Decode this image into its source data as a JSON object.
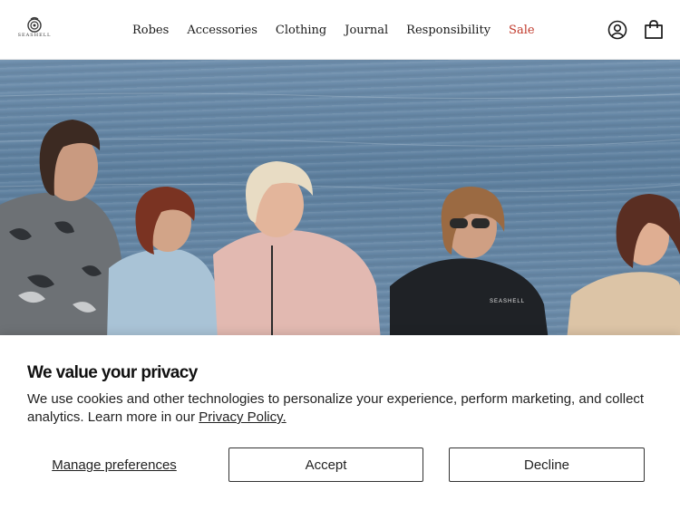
{
  "brand": {
    "logo_text": "SEASHELL"
  },
  "nav": {
    "items": [
      {
        "label": "Robes"
      },
      {
        "label": "Accessories"
      },
      {
        "label": "Clothing"
      },
      {
        "label": "Journal"
      },
      {
        "label": "Responsibility"
      },
      {
        "label": "Sale"
      }
    ]
  },
  "hero": {
    "robe_print": "SEASHELL"
  },
  "consent": {
    "title": "We value your privacy",
    "body": "We use cookies and other technologies to personalize your experience, perform marketing, and collect analytics. Learn more in our ",
    "policy_link": "Privacy Policy.",
    "manage_label": "Manage preferences",
    "accept_label": "Accept",
    "decline_label": "Decline"
  },
  "colors": {
    "sale": "#c0392b",
    "water": "#6a8aa8"
  }
}
